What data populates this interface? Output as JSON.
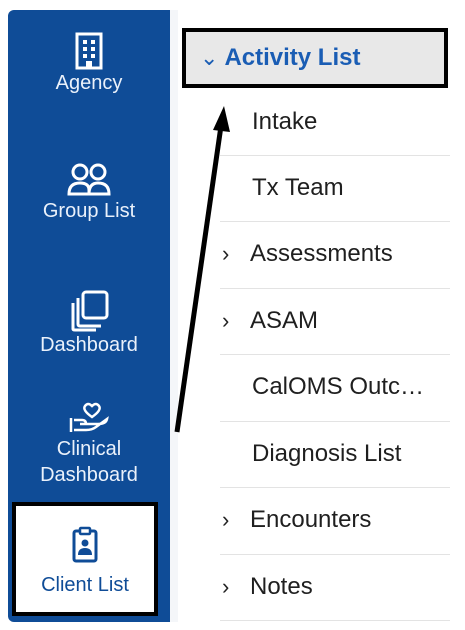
{
  "sidebar": {
    "items": [
      {
        "label": "Agency",
        "icon": "building-icon"
      },
      {
        "label": "Group List",
        "icon": "group-icon"
      },
      {
        "label": "Dashboard",
        "icon": "dashboard-icon"
      },
      {
        "label": "Clinical Dashboard",
        "icon": "clinical-hands-heart-icon"
      },
      {
        "label": "Client List",
        "icon": "clipboard-person-icon"
      }
    ],
    "colors": {
      "background": "#0f4c97",
      "active_text": "#0f4c97"
    }
  },
  "menu": {
    "header": {
      "label": "Activity List",
      "expanded": true,
      "color": "#1a5db4"
    },
    "items": [
      {
        "label": "Intake",
        "expandable": false
      },
      {
        "label": "Tx Team",
        "expandable": false
      },
      {
        "label": "Assessments",
        "expandable": true
      },
      {
        "label": "ASAM",
        "expandable": true
      },
      {
        "label": "CalOMS Outc…",
        "expandable": false
      },
      {
        "label": "Diagnosis List",
        "expandable": false
      },
      {
        "label": "Encounters",
        "expandable": true
      },
      {
        "label": "Notes",
        "expandable": true
      }
    ]
  }
}
